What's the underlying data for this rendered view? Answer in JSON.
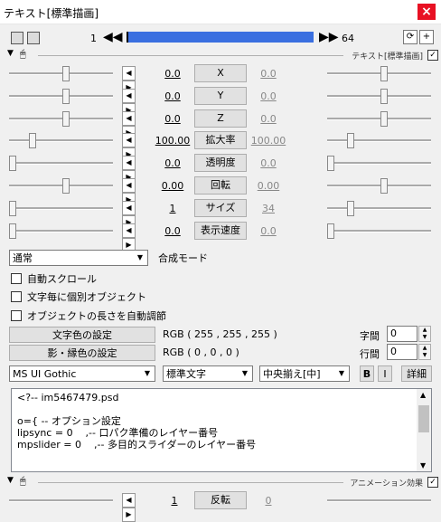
{
  "window": {
    "title": "テキスト[標準描画]",
    "close": "×"
  },
  "toolbar": {
    "frame_start": "1",
    "frame_end": "64",
    "prev": "◀◀",
    "next": "▶▶"
  },
  "section1": {
    "label": "テキスト[標準描画]",
    "checked": "✓"
  },
  "params": [
    {
      "name": "X",
      "left": "0.0",
      "right": "0.0",
      "left_level": 0.55,
      "right_level": 0.55
    },
    {
      "name": "Y",
      "left": "0.0",
      "right": "0.0",
      "left_level": 0.55,
      "right_level": 0.55
    },
    {
      "name": "Z",
      "left": "0.0",
      "right": "0.0",
      "left_level": 0.55,
      "right_level": 0.55
    },
    {
      "name": "拡大率",
      "left": "100.00",
      "right": "100.00",
      "left_level": 0.2,
      "right_level": 0.2
    },
    {
      "name": "透明度",
      "left": "0.0",
      "right": "0.0",
      "left_level": 0.0,
      "right_level": 0.0
    },
    {
      "name": "回転",
      "left": "0.00",
      "right": "0.00",
      "left_level": 0.55,
      "right_level": 0.55
    },
    {
      "name": "サイズ",
      "left": "1",
      "right": "34",
      "left_level": 0.0,
      "right_level": 0.2
    },
    {
      "name": "表示速度",
      "left": "0.0",
      "right": "0.0",
      "left_level": 0.0,
      "right_level": 0.0
    }
  ],
  "blend": {
    "value": "通常",
    "label": "合成モード"
  },
  "checks": [
    "自動スクロール",
    "文字毎に個別オブジェクト",
    "オブジェクトの長さを自動調節"
  ],
  "color": {
    "text_btn": "文字色の設定",
    "text_rgb": "RGB ( 255 , 255 , 255 )",
    "shadow_btn": "影・縁色の設定",
    "shadow_rgb": "RGB ( 0 , 0 , 0 )"
  },
  "spacing": {
    "char_label": "字間",
    "char_value": "0",
    "line_label": "行間",
    "line_value": "0"
  },
  "font": {
    "family": "MS UI Gothic",
    "style": "標準文字",
    "align": "中央揃え[中]",
    "bold": "B",
    "italic": "I",
    "detail": "詳細"
  },
  "text_content": "<?-- im5467479.psd\n\no={ -- オプション設定\nlipsync = 0    ,-- 口パク準備のレイヤー番号\nmpslider = 0    ,-- 多目的スライダーのレイヤー番号",
  "section2": {
    "label": "アニメーション効果",
    "checked": "✓",
    "param_name": "反転",
    "left": "1",
    "right": "0"
  }
}
